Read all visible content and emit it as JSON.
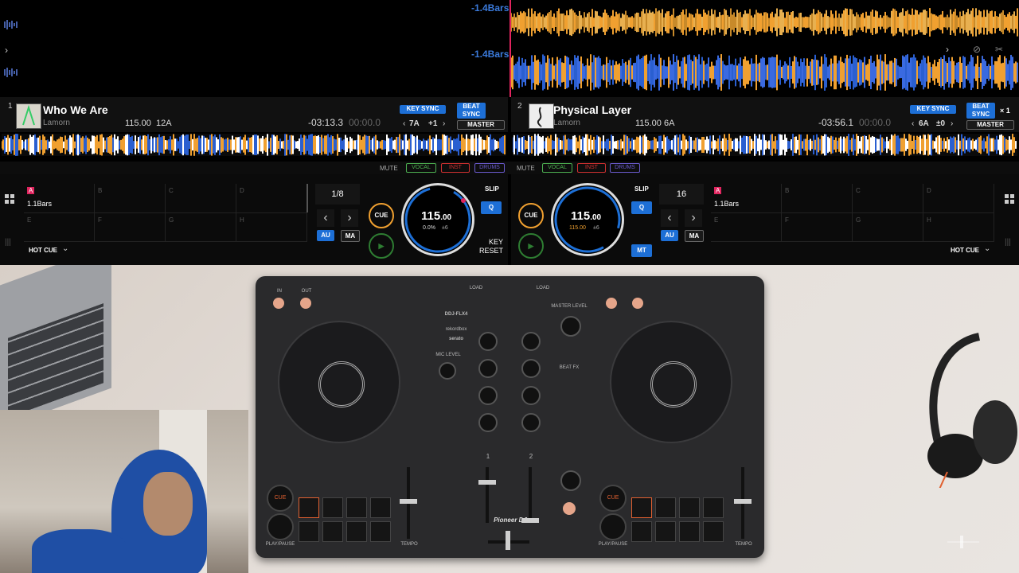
{
  "top": {
    "bars_label_a": "-1.4Bars",
    "bars_label_b": "-1.4Bars"
  },
  "deck1": {
    "number": "1",
    "title": "Who We Are",
    "artist": "Lamorn",
    "bpm": "115.00",
    "key": "12A",
    "time_remaining": "-03:13.3",
    "time_elapsed": "00:00.0",
    "key_sync": "KEY SYNC",
    "beat_sync": "BEAT SYNC",
    "key_current": "7A",
    "key_shift": "+1",
    "master": "MASTER"
  },
  "deck2": {
    "number": "2",
    "title": "Physical Layer",
    "artist": "Lamorn",
    "bpm": "115.00",
    "key": "6A",
    "time_remaining": "-03:56.1",
    "time_elapsed": "00:00.0",
    "key_sync": "KEY SYNC",
    "beat_sync": "BEAT SYNC",
    "close": "× 1",
    "key_current": "6A",
    "key_shift": "±0",
    "master": "MASTER"
  },
  "mute_row": {
    "mute": "MUTE",
    "vocal": "VOCAL",
    "inst": "INST",
    "drums": "DRUMS"
  },
  "perf1": {
    "pads": [
      "A",
      "B",
      "C",
      "D",
      "E",
      "F",
      "G",
      "H"
    ],
    "pad_a_label": "1.1Bars",
    "hot_cue": "HOT CUE",
    "loop": "1/8",
    "au": "AU",
    "ma": "MA",
    "cue": "CUE",
    "bpm_big": "115",
    "bpm_dec": ".00",
    "pitch": "0.0%",
    "range": "±6",
    "slip": "SLIP",
    "q": "Q",
    "key_reset": "KEY\nRESET"
  },
  "perf2": {
    "pads": [
      "A",
      "B",
      "C",
      "D",
      "E",
      "F",
      "G",
      "H"
    ],
    "pad_a_label": "1.1Bars",
    "hot_cue": "HOT CUE",
    "loop": "16",
    "au": "AU",
    "ma": "MA",
    "cue": "CUE",
    "bpm_big": "115",
    "bpm_dec": ".00",
    "pitch": "115.00",
    "range": "±6",
    "slip": "SLIP",
    "q": "Q",
    "mt": "MT"
  },
  "controller": {
    "model": "DDJ-FLX4",
    "brand": "Pioneer DJ",
    "rekordbox": "rekordbox",
    "serato": "serato",
    "beat_fx": "BEAT FX",
    "ch1": "1",
    "ch2": "2",
    "cue_l": "CUE",
    "cue_r": "CUE",
    "tempo": "TEMPO",
    "play": "PLAY/PAUSE",
    "master_level": "MASTER LEVEL",
    "mic_level": "MIC LEVEL",
    "load": "LOAD",
    "in": "IN",
    "out": "OUT"
  },
  "colors": {
    "accent_blue": "#1d6fd6",
    "waveform_orange": "#f0a030",
    "waveform_blue": "#2a5fd0",
    "pad_red": "#e0245e",
    "vocal_green": "#4caf50",
    "inst_red": "#d03030",
    "drums_purple": "#6a5acd"
  }
}
